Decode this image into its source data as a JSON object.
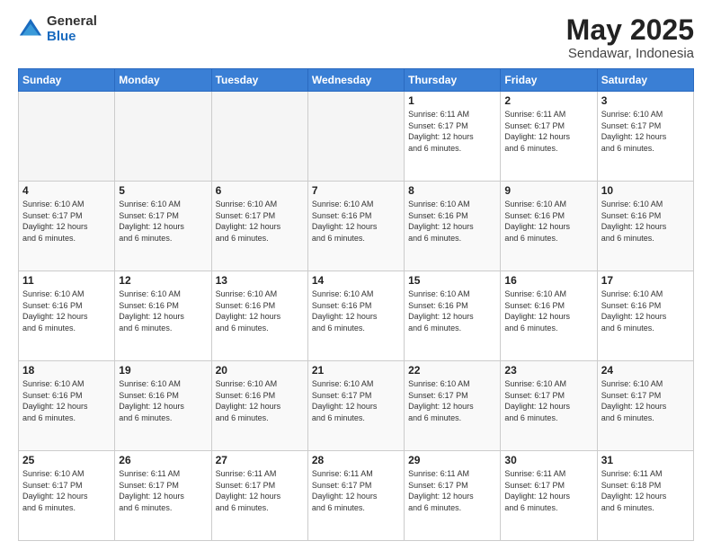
{
  "header": {
    "logo_general": "General",
    "logo_blue": "Blue",
    "title": "May 2025",
    "subtitle": "Sendawar, Indonesia"
  },
  "days_of_week": [
    "Sunday",
    "Monday",
    "Tuesday",
    "Wednesday",
    "Thursday",
    "Friday",
    "Saturday"
  ],
  "weeks": [
    [
      {
        "day": "",
        "info": "",
        "empty": true
      },
      {
        "day": "",
        "info": "",
        "empty": true
      },
      {
        "day": "",
        "info": "",
        "empty": true
      },
      {
        "day": "",
        "info": "",
        "empty": true
      },
      {
        "day": "1",
        "info": "Sunrise: 6:11 AM\nSunset: 6:17 PM\nDaylight: 12 hours\nand 6 minutes."
      },
      {
        "day": "2",
        "info": "Sunrise: 6:11 AM\nSunset: 6:17 PM\nDaylight: 12 hours\nand 6 minutes."
      },
      {
        "day": "3",
        "info": "Sunrise: 6:10 AM\nSunset: 6:17 PM\nDaylight: 12 hours\nand 6 minutes."
      }
    ],
    [
      {
        "day": "4",
        "info": "Sunrise: 6:10 AM\nSunset: 6:17 PM\nDaylight: 12 hours\nand 6 minutes."
      },
      {
        "day": "5",
        "info": "Sunrise: 6:10 AM\nSunset: 6:17 PM\nDaylight: 12 hours\nand 6 minutes."
      },
      {
        "day": "6",
        "info": "Sunrise: 6:10 AM\nSunset: 6:17 PM\nDaylight: 12 hours\nand 6 minutes."
      },
      {
        "day": "7",
        "info": "Sunrise: 6:10 AM\nSunset: 6:16 PM\nDaylight: 12 hours\nand 6 minutes."
      },
      {
        "day": "8",
        "info": "Sunrise: 6:10 AM\nSunset: 6:16 PM\nDaylight: 12 hours\nand 6 minutes."
      },
      {
        "day": "9",
        "info": "Sunrise: 6:10 AM\nSunset: 6:16 PM\nDaylight: 12 hours\nand 6 minutes."
      },
      {
        "day": "10",
        "info": "Sunrise: 6:10 AM\nSunset: 6:16 PM\nDaylight: 12 hours\nand 6 minutes."
      }
    ],
    [
      {
        "day": "11",
        "info": "Sunrise: 6:10 AM\nSunset: 6:16 PM\nDaylight: 12 hours\nand 6 minutes."
      },
      {
        "day": "12",
        "info": "Sunrise: 6:10 AM\nSunset: 6:16 PM\nDaylight: 12 hours\nand 6 minutes."
      },
      {
        "day": "13",
        "info": "Sunrise: 6:10 AM\nSunset: 6:16 PM\nDaylight: 12 hours\nand 6 minutes."
      },
      {
        "day": "14",
        "info": "Sunrise: 6:10 AM\nSunset: 6:16 PM\nDaylight: 12 hours\nand 6 minutes."
      },
      {
        "day": "15",
        "info": "Sunrise: 6:10 AM\nSunset: 6:16 PM\nDaylight: 12 hours\nand 6 minutes."
      },
      {
        "day": "16",
        "info": "Sunrise: 6:10 AM\nSunset: 6:16 PM\nDaylight: 12 hours\nand 6 minutes."
      },
      {
        "day": "17",
        "info": "Sunrise: 6:10 AM\nSunset: 6:16 PM\nDaylight: 12 hours\nand 6 minutes."
      }
    ],
    [
      {
        "day": "18",
        "info": "Sunrise: 6:10 AM\nSunset: 6:16 PM\nDaylight: 12 hours\nand 6 minutes."
      },
      {
        "day": "19",
        "info": "Sunrise: 6:10 AM\nSunset: 6:16 PM\nDaylight: 12 hours\nand 6 minutes."
      },
      {
        "day": "20",
        "info": "Sunrise: 6:10 AM\nSunset: 6:16 PM\nDaylight: 12 hours\nand 6 minutes."
      },
      {
        "day": "21",
        "info": "Sunrise: 6:10 AM\nSunset: 6:17 PM\nDaylight: 12 hours\nand 6 minutes."
      },
      {
        "day": "22",
        "info": "Sunrise: 6:10 AM\nSunset: 6:17 PM\nDaylight: 12 hours\nand 6 minutes."
      },
      {
        "day": "23",
        "info": "Sunrise: 6:10 AM\nSunset: 6:17 PM\nDaylight: 12 hours\nand 6 minutes."
      },
      {
        "day": "24",
        "info": "Sunrise: 6:10 AM\nSunset: 6:17 PM\nDaylight: 12 hours\nand 6 minutes."
      }
    ],
    [
      {
        "day": "25",
        "info": "Sunrise: 6:10 AM\nSunset: 6:17 PM\nDaylight: 12 hours\nand 6 minutes."
      },
      {
        "day": "26",
        "info": "Sunrise: 6:11 AM\nSunset: 6:17 PM\nDaylight: 12 hours\nand 6 minutes."
      },
      {
        "day": "27",
        "info": "Sunrise: 6:11 AM\nSunset: 6:17 PM\nDaylight: 12 hours\nand 6 minutes."
      },
      {
        "day": "28",
        "info": "Sunrise: 6:11 AM\nSunset: 6:17 PM\nDaylight: 12 hours\nand 6 minutes."
      },
      {
        "day": "29",
        "info": "Sunrise: 6:11 AM\nSunset: 6:17 PM\nDaylight: 12 hours\nand 6 minutes."
      },
      {
        "day": "30",
        "info": "Sunrise: 6:11 AM\nSunset: 6:17 PM\nDaylight: 12 hours\nand 6 minutes."
      },
      {
        "day": "31",
        "info": "Sunrise: 6:11 AM\nSunset: 6:18 PM\nDaylight: 12 hours\nand 6 minutes."
      }
    ]
  ]
}
